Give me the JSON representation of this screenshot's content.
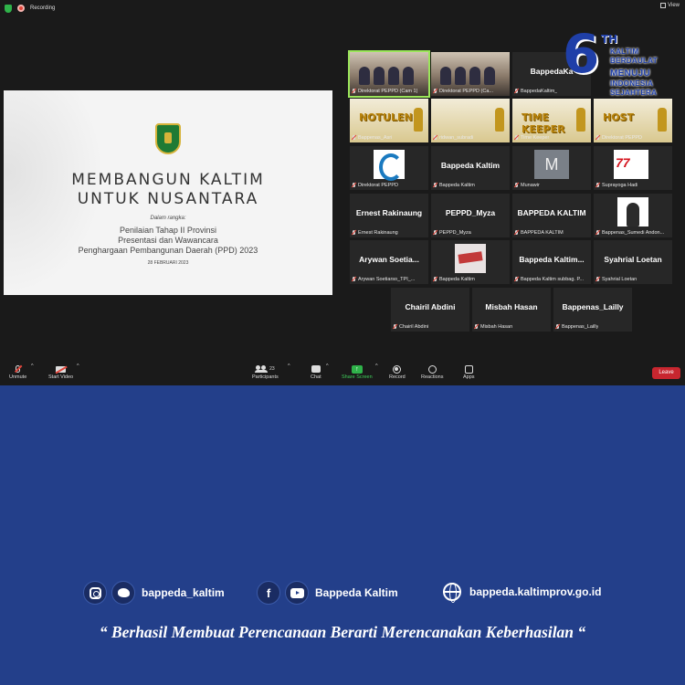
{
  "window": {
    "recording_label": "Recording",
    "view_label": "View"
  },
  "slide": {
    "title_line1": "MEMBANGUN KALTIM",
    "title_line2": "UNTUK NUSANTARA",
    "context_label": "Dalam rangka:",
    "line1": "Penilaian Tahap II Provinsi",
    "line2": "Presentasi dan Wawancara",
    "line3": "Penghargaan Pembangunan Daerah (PPD) 2023",
    "date": "28 FEBRUARI 2023"
  },
  "badge": {
    "number": "6",
    "suffix": "TH",
    "line1": "KALTIM",
    "line2": "BERDAULAT",
    "line3": "MENUJU",
    "line4": "INDONESIA",
    "line5": "SEJAHTERA"
  },
  "tiles": [
    {
      "display": "",
      "label": "Direktorat PEPPD (Cam 1)",
      "kind": "room",
      "active": true
    },
    {
      "display": "",
      "label": "Direktorat PEPPD (Ca...",
      "kind": "room"
    },
    {
      "display": "BappedaKa",
      "label": "BappedaKaltim_",
      "kind": "name"
    },
    {
      "display": "",
      "label": "",
      "kind": "badge"
    },
    {
      "display": "NOTULEN",
      "label": "Bappenas_Asri",
      "kind": "gold"
    },
    {
      "display": "",
      "label": "ridwan_subradi",
      "kind": "gold"
    },
    {
      "display": "TIME KEEPER",
      "label": "Time Keeper",
      "kind": "gold"
    },
    {
      "display": "HOST",
      "label": "Direktorat PEPPD",
      "kind": "gold"
    },
    {
      "display": "",
      "label": "Direktorat PEPPD",
      "kind": "logo"
    },
    {
      "display": "Bappeda Kaltim",
      "label": "Bappeda Kaltim",
      "kind": "name"
    },
    {
      "display": "M",
      "label": "Munawir",
      "kind": "avatar"
    },
    {
      "display": "",
      "label": "Suprayoga Hadi",
      "kind": "hut"
    },
    {
      "display": "Ernest Rakinaung",
      "label": "Ernest Rakinaung",
      "kind": "name"
    },
    {
      "display": "PEPPD_Myza",
      "label": "PEPPD_Myza",
      "kind": "name"
    },
    {
      "display": "BAPPEDA KALTIM",
      "label": "BAPPEDA KALTIM",
      "kind": "name"
    },
    {
      "display": "",
      "label": "Bappenas_Sumedi Andon...",
      "kind": "photo"
    },
    {
      "display": "Arywan Soetia...",
      "label": "Arywan Soetiarso_TPI_...",
      "kind": "name"
    },
    {
      "display": "",
      "label": "Bappeda Kaltim",
      "kind": "eval"
    },
    {
      "display": "Bappeda Kaltim...",
      "label": "Bappeda Kaltim subbag. P...",
      "kind": "name"
    },
    {
      "display": "Syahrial Loetan",
      "label": "Syahrial Loetan",
      "kind": "name"
    },
    {
      "display": "Chairil Abdini",
      "label": "Chairil Abdini",
      "kind": "name"
    },
    {
      "display": "Misbah Hasan",
      "label": "Misbah Hasan",
      "kind": "name"
    },
    {
      "display": "Bappenas_Lailly",
      "label": "Bappenas_Lailly",
      "kind": "name"
    }
  ],
  "toolbar": {
    "unmute": "Unmute",
    "start_video": "Start Video",
    "participants": "Participants",
    "participant_count": "23",
    "chat": "Chat",
    "share_screen": "Share Screen",
    "record": "Record",
    "reactions": "Reactions",
    "apps": "Apps",
    "leave": "Leave"
  },
  "footer": {
    "instagram_twitter": "bappeda_kaltim",
    "facebook_youtube": "Bappeda Kaltim",
    "website": "bappeda.kaltimprov.go.id",
    "quote": "“ Berhasil  Membuat Perencanaan Berarti Merencanakan Keberhasilan “"
  },
  "colors": {
    "footer_bg": "#233f8a",
    "zoom_bg": "#1a1a1a",
    "share_green": "#2fb34a",
    "leave_red": "#c8262f"
  }
}
